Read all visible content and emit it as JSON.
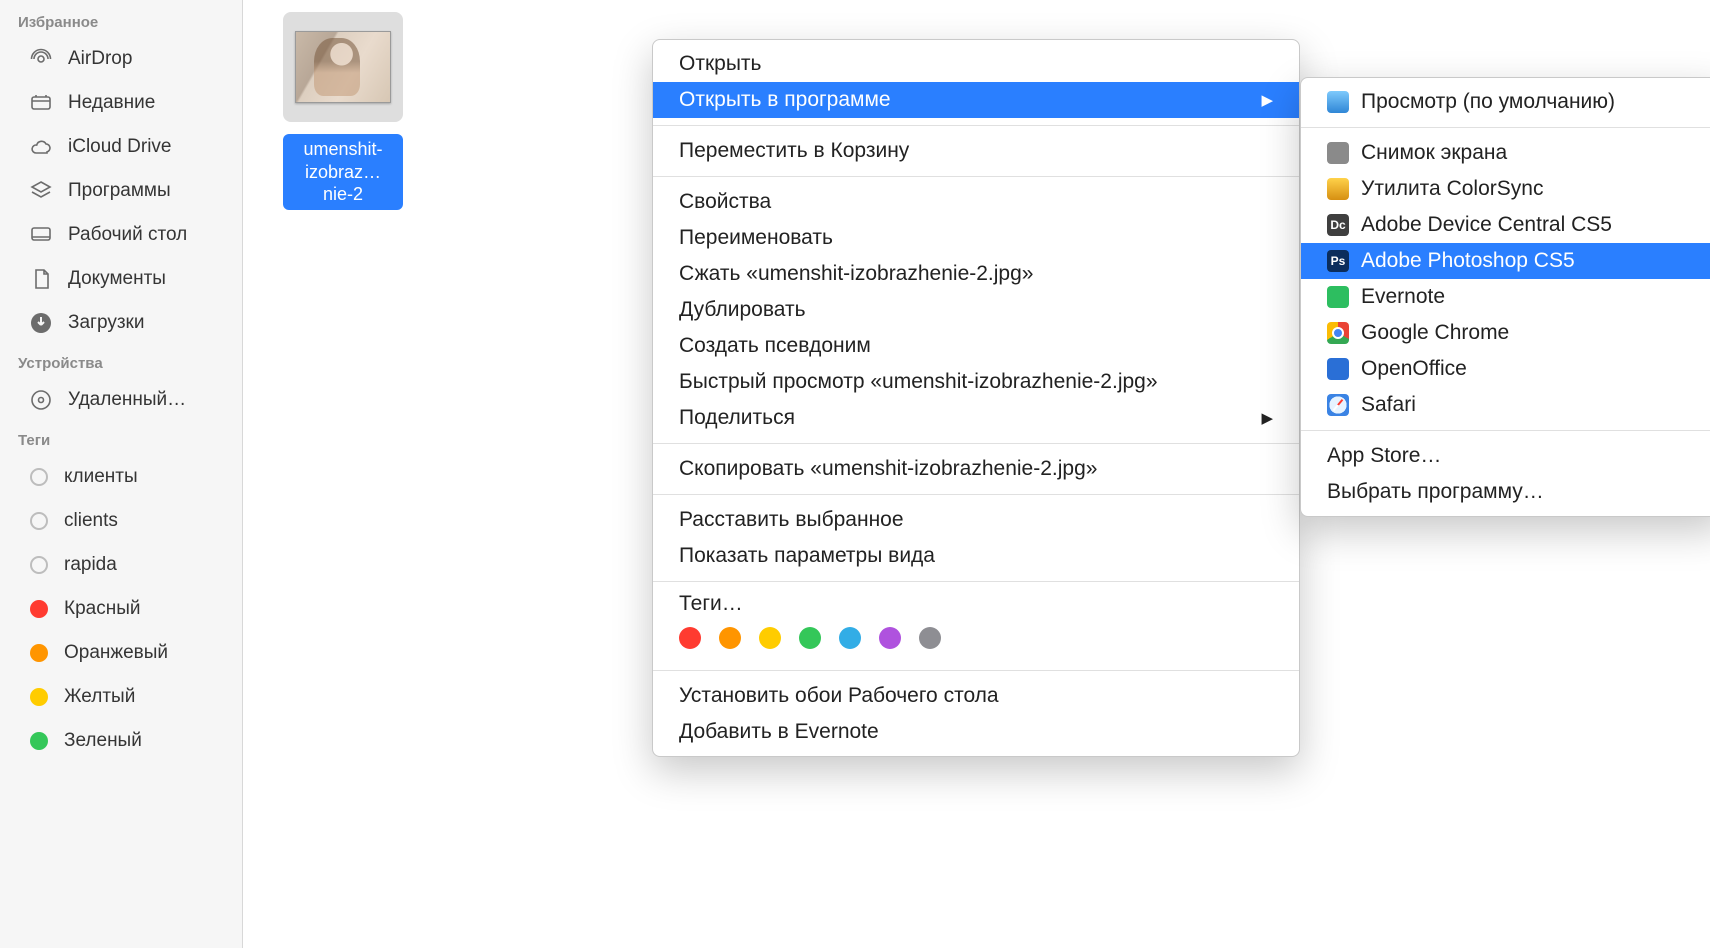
{
  "sidebar": {
    "sections": [
      {
        "title": "Избранное",
        "items": [
          {
            "icon": "airdrop",
            "label": "AirDrop"
          },
          {
            "icon": "recents",
            "label": "Недавние"
          },
          {
            "icon": "icloud",
            "label": "iCloud Drive"
          },
          {
            "icon": "apps",
            "label": "Программы"
          },
          {
            "icon": "desktop",
            "label": "Рабочий стол"
          },
          {
            "icon": "documents",
            "label": "Документы"
          },
          {
            "icon": "downloads",
            "label": "Загрузки"
          }
        ]
      },
      {
        "title": "Устройства",
        "items": [
          {
            "icon": "disc",
            "label": "Удаленный…"
          }
        ]
      },
      {
        "title": "Теги",
        "items": [
          {
            "icon": "tag-empty",
            "label": "клиенты"
          },
          {
            "icon": "tag-empty",
            "label": "clients"
          },
          {
            "icon": "tag-empty",
            "label": "rapida"
          },
          {
            "icon": "tag-red",
            "label": "Красный",
            "color": "#ff3b30"
          },
          {
            "icon": "tag-orange",
            "label": "Оранжевый",
            "color": "#ff9500"
          },
          {
            "icon": "tag-yellow",
            "label": "Желтый",
            "color": "#ffcc00"
          },
          {
            "icon": "tag-green",
            "label": "Зеленый",
            "color": "#34c759"
          }
        ]
      }
    ]
  },
  "file": {
    "display_name": "umenshit-izobraz…nie-2"
  },
  "context_menu": {
    "items": [
      {
        "label": "Открыть"
      },
      {
        "label": "Открыть в программе",
        "submenu": true,
        "highlighted": true
      },
      {
        "sep": true
      },
      {
        "label": "Переместить в Корзину"
      },
      {
        "sep": true
      },
      {
        "label": "Свойства"
      },
      {
        "label": "Переименовать"
      },
      {
        "label": "Сжать «umenshit-izobrazhenie-2.jpg»"
      },
      {
        "label": "Дублировать"
      },
      {
        "label": "Создать псевдоним"
      },
      {
        "label": "Быстрый просмотр «umenshit-izobrazhenie-2.jpg»"
      },
      {
        "label": "Поделиться",
        "submenu": true
      },
      {
        "sep": true
      },
      {
        "label": "Скопировать «umenshit-izobrazhenie-2.jpg»"
      },
      {
        "sep": true
      },
      {
        "label": "Расставить выбранное"
      },
      {
        "label": "Показать параметры вида"
      },
      {
        "sep": true
      },
      {
        "label": "Теги…",
        "tags_row": true
      },
      {
        "sep": true
      },
      {
        "label": "Установить обои Рабочего стола"
      },
      {
        "label": "Добавить в Evernote"
      }
    ],
    "tag_colors": [
      "#ff3b30",
      "#ff9500",
      "#ffcc00",
      "#34c759",
      "#32ade6",
      "#af52de",
      "#8e8e93"
    ]
  },
  "open_with_submenu": {
    "items": [
      {
        "icon": "preview",
        "label": "Просмотр (по умолчанию)"
      },
      {
        "sep": true
      },
      {
        "icon": "screenshot",
        "label": "Снимок экрана"
      },
      {
        "icon": "colorsync",
        "label": "Утилита ColorSync"
      },
      {
        "icon": "devcentral",
        "label": "Adobe Device Central CS5"
      },
      {
        "icon": "photoshop",
        "label": "Adobe Photoshop CS5",
        "highlighted": true
      },
      {
        "icon": "evernote",
        "label": "Evernote"
      },
      {
        "icon": "chrome",
        "label": "Google Chrome"
      },
      {
        "icon": "openoffice",
        "label": "OpenOffice"
      },
      {
        "icon": "safari",
        "label": "Safari"
      },
      {
        "sep": true
      },
      {
        "label": "App Store…"
      },
      {
        "label": "Выбрать программу…"
      }
    ]
  }
}
